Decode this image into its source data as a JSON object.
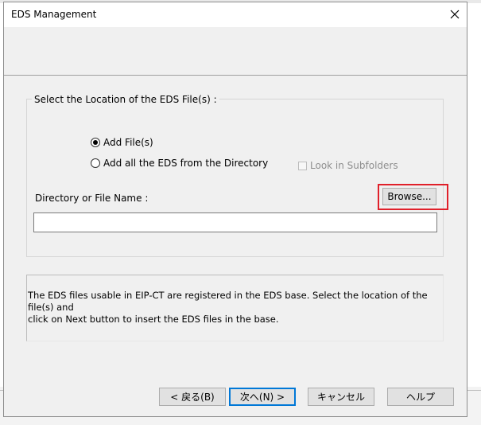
{
  "dialog": {
    "title": "EDS Management",
    "close_icon": "close-icon"
  },
  "location_group": {
    "legend": "Select the Location of the EDS File(s) :",
    "radio_add_files": {
      "label": "Add File(s)",
      "checked": true
    },
    "radio_add_all": {
      "label": "Add all the EDS from the Directory",
      "checked": false
    },
    "checkbox_subfolders": {
      "label": "Look in Subfolders",
      "checked": false,
      "enabled": false
    },
    "directory_label": "Directory or File Name :",
    "browse_label": "Browse...",
    "path_value": ""
  },
  "info": {
    "line1": "The EDS files usable in EIP-CT are registered in the EDS base. Select the location of the file(s) and",
    "line2": "click on Next button to insert the EDS files in the base."
  },
  "buttons": {
    "back": "< 戻る(B)",
    "next": "次へ(N) >",
    "cancel": "キャンセル",
    "help": "ヘルプ"
  },
  "colors": {
    "highlight": "#e0202a",
    "default_button_border": "#0078d7"
  }
}
